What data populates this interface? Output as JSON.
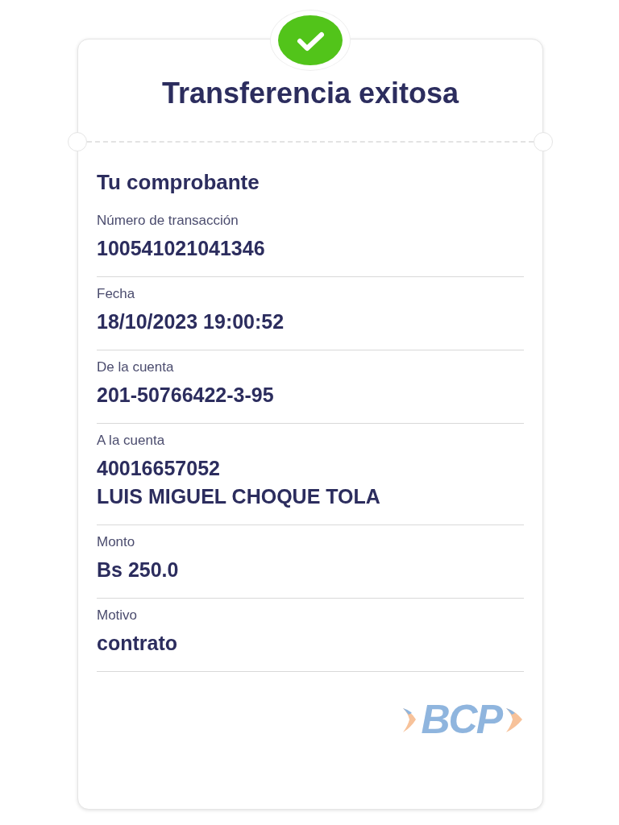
{
  "header": {
    "title": "Transferencia exitosa"
  },
  "receipt": {
    "heading": "Tu comprobante",
    "fields": [
      {
        "label": "Número de transacción",
        "values": [
          "100541021041346"
        ]
      },
      {
        "label": "Fecha",
        "values": [
          "18/10/2023 19:00:52"
        ]
      },
      {
        "label": "De la cuenta",
        "values": [
          "201-50766422-3-95"
        ]
      },
      {
        "label": "A la cuenta",
        "values": [
          "40016657052",
          "LUIS MIGUEL CHOQUE TOLA"
        ]
      },
      {
        "label": "Monto",
        "values": [
          "Bs 250.0"
        ]
      },
      {
        "label": "Motivo",
        "values": [
          "contrato"
        ]
      }
    ]
  },
  "logo": {
    "text": "BCP"
  }
}
